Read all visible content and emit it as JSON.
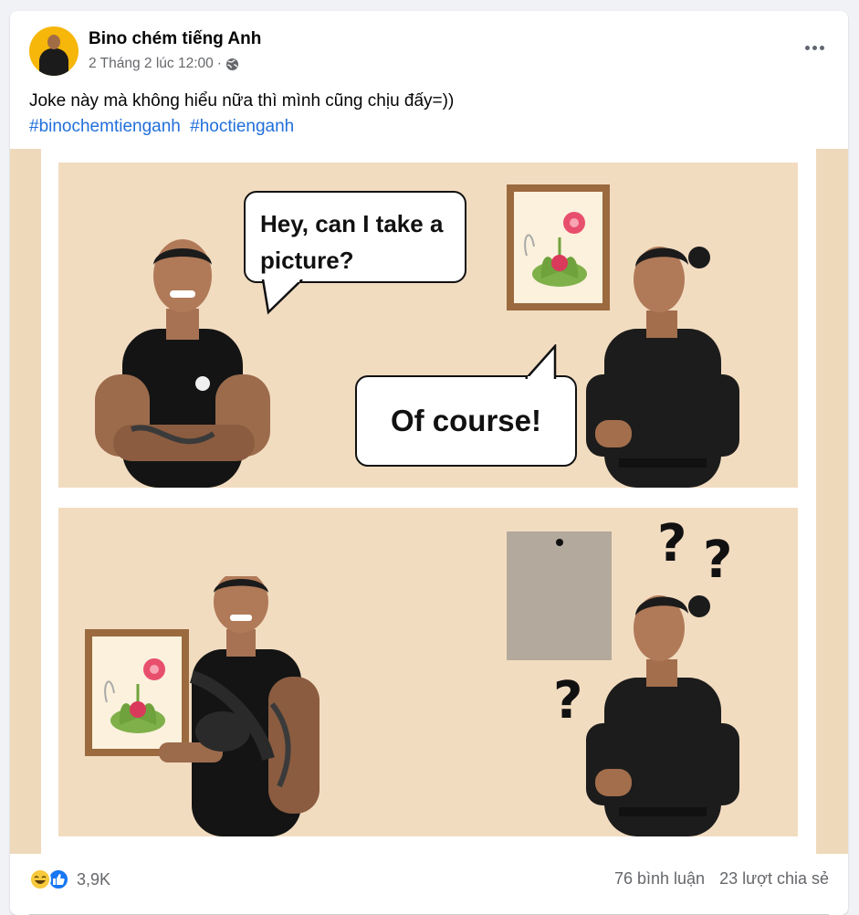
{
  "post": {
    "author": "Bino chém tiếng Anh",
    "timestamp": "2 Tháng 2 lúc 12:00",
    "separator": "·",
    "privacy_icon": "globe-icon",
    "more_icon": "more-horizontal-icon",
    "caption": "Joke này mà không hiểu nữa thì mình cũng chịu đấy=))",
    "hashtags": [
      "#binochemtienganh",
      "#hoctienganh"
    ]
  },
  "image": {
    "bubble1": "Hey, can I take a picture?",
    "bubble2": "Of course!",
    "question_mark": "?"
  },
  "footer": {
    "reaction_icons": [
      "haha-icon",
      "like-icon"
    ],
    "reaction_count": "3,9K",
    "comments": "76 bình luận",
    "shares": "23 lượt chia sẻ"
  },
  "colors": {
    "link": "#216fdb",
    "secondary_text": "#65676b",
    "image_background": "#f2dcc0",
    "frame": "#9b6a3f",
    "like": "#1877f2"
  }
}
